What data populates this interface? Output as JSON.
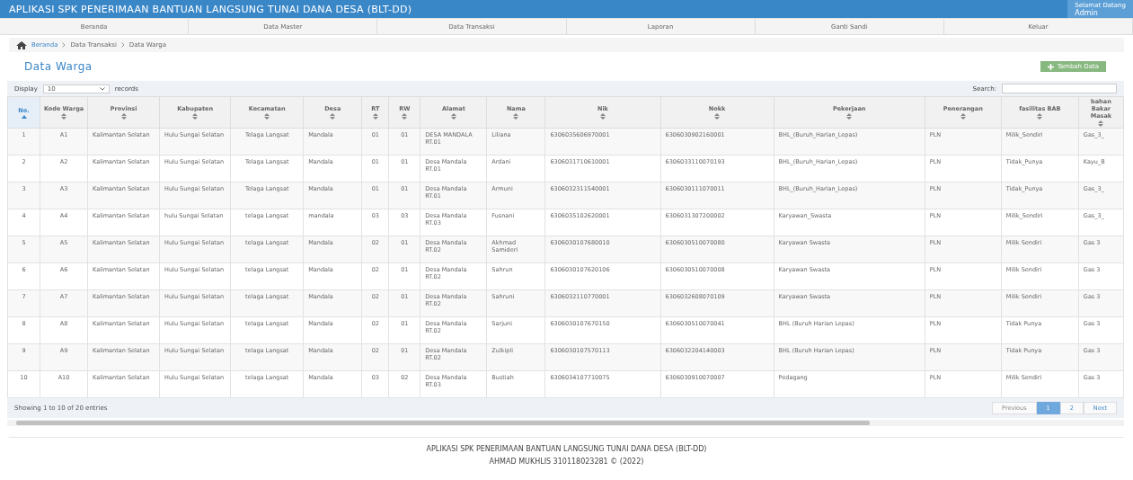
{
  "header": {
    "title": "APLIKASI SPK PENERIMAAN BANTUAN LANGSUNG TUNAI DANA DESA (BLT-DD)",
    "greeting": "Selamat Datang",
    "user": "Admin"
  },
  "nav": [
    {
      "label": "Beranda"
    },
    {
      "label": "Data Master"
    },
    {
      "label": "Data Transaksi"
    },
    {
      "label": "Laporan"
    },
    {
      "label": "Ganti Sandi"
    },
    {
      "label": "Keluar"
    }
  ],
  "breadcrumb": [
    {
      "label": "Beranda",
      "link": true
    },
    {
      "label": "Data Transaksi",
      "link": false
    },
    {
      "label": "Data Warga",
      "link": false
    }
  ],
  "page_title": "Data Warga",
  "add_button": "Tambah Data",
  "length": {
    "label": "Display",
    "value": "10",
    "suffix": "records"
  },
  "search": {
    "label": "Search:"
  },
  "table": {
    "columns": [
      {
        "label": "No.",
        "sorted": true
      },
      {
        "label": "Kode Warga",
        "sorted": false
      },
      {
        "label": "Provinsi",
        "sorted": false
      },
      {
        "label": "Kabupaten",
        "sorted": false
      },
      {
        "label": "Kecamatan",
        "sorted": false
      },
      {
        "label": "Desa",
        "sorted": false
      },
      {
        "label": "RT",
        "sorted": false
      },
      {
        "label": "RW",
        "sorted": false
      },
      {
        "label": "Alamat",
        "sorted": false
      },
      {
        "label": "Nama",
        "sorted": false
      },
      {
        "label": "Nik",
        "sorted": false
      },
      {
        "label": "Nokk",
        "sorted": false
      },
      {
        "label": "Pekerjaan",
        "sorted": false
      },
      {
        "label": "Penerangan",
        "sorted": false
      },
      {
        "label": "fasilitas BAB",
        "sorted": false
      },
      {
        "label": "bahan Bakar Masak",
        "sorted": false
      }
    ],
    "rows": [
      [
        "1",
        "A1",
        "Kalimantan Selatan",
        "Hulu Sungai Selatan",
        "Telaga Langsat",
        "Mandala",
        "01",
        "01",
        "DESA MANDALA RT.01",
        "Liliana",
        "6306035606970001",
        "6306030902160001",
        "BHL_(Buruh_Harian_Lepas)",
        "PLN",
        "Milik_Sendiri",
        "Gas_3_"
      ],
      [
        "2",
        "A2",
        "Kalimantan Selatan",
        "Hulu Sungai Selatan",
        "Telaga Langsat",
        "Mandala",
        "01",
        "01",
        "Desa Mandala RT.01",
        "Ardani",
        "6306031710610001",
        "6306033110070193",
        "BHL_(Buruh_Harian_Lepas)",
        "PLN",
        "Tidak_Punya",
        "Kayu_B"
      ],
      [
        "3",
        "A3",
        "Kalimantan Selatan",
        "Hulu Sungai Selatan",
        "Telaga Langsat",
        "Mandala",
        "01",
        "01",
        "Desa Mandala RT.01",
        "Armuni",
        "6306032311540001",
        "6306030111070011",
        "BHL_(Buruh_Harian_Lepas)",
        "PLN",
        "Tidak_Punya",
        "Gas_3_"
      ],
      [
        "4",
        "A4",
        "Kalimantan Selatan",
        "hulu Sungai Selatan",
        "telaga Langsat",
        "mandala",
        "03",
        "03",
        "Desa Mandala RT.03",
        "Fusnani",
        "6306035102620001",
        "6306031307200002",
        "Karyawan_Swasta",
        "PLN",
        "Milik_Sendiri",
        "Gas_3_"
      ],
      [
        "5",
        "A5",
        "Kalimantan Selatan",
        "Hulu Sungai Selatan",
        "telaga Langsat",
        "Mandala",
        "02",
        "01",
        "Desa Mandala RT.02",
        "Akhmad Samideri",
        "6306030107680010",
        "6306030510070080",
        "Karyawan Swasta",
        "PLN",
        "Milik Sendiri",
        "Gas 3"
      ],
      [
        "6",
        "A6",
        "Kalimantan Selatan",
        "Hulu Sungai Selatan",
        "telaga Langsat",
        "Mandala",
        "02",
        "01",
        "Desa Mandala RT.02",
        "Sahrun",
        "6306030107620106",
        "6306030510070008",
        "Karyawan Swasta",
        "PLN",
        "Milik Sendiri",
        "Gas 3"
      ],
      [
        "7",
        "A7",
        "Kalimantan Selatan",
        "Hulu Sungai Selatan",
        "telaga Langsat",
        "Mandala",
        "02",
        "01",
        "Desa Mandala RT.02",
        "Sahruni",
        "6306032110770001",
        "6306032608070109",
        "Karyawan Swasta",
        "PLN",
        "Milik Sendiri",
        "Gas 3"
      ],
      [
        "8",
        "A8",
        "Kalimantan Selatan",
        "Hulu Sungai Selatan",
        "telaga Langsat",
        "Mandala",
        "02",
        "01",
        "Desa Mandala RT.02",
        "Sarjuni",
        "6306030107670150",
        "6306030510070041",
        "BHL (Buruh Harian Lepas)",
        "PLN",
        "Tidak Punya",
        "Gas 3"
      ],
      [
        "9",
        "A9",
        "Kalimantan Selatan",
        "Hulu Sungai Selatan",
        "telaga Langsat",
        "Mandala",
        "02",
        "01",
        "Desa Mandala RT.02",
        "Zulkipli",
        "6306030107570113",
        "6306032204140003",
        "BHL (Buruh Harian Lepas)",
        "PLN",
        "Tidak Punya",
        "Gas 3"
      ],
      [
        "10",
        "A10",
        "Kalimantan Selatan",
        "Hulu Sungai Selatan",
        "telaga Langsat",
        "Mandala",
        "03",
        "02",
        "Desa Mandala RT.03",
        "Bustiah",
        "6306034107710075",
        "6306030910070007",
        "Pedagang",
        "PLN",
        "Milik Sendiri",
        "Gas 3"
      ]
    ]
  },
  "info": "Showing 1 to 10 of 20 entries",
  "pagination": [
    {
      "label": "Previous",
      "selected": false
    },
    {
      "label": "1",
      "selected": true
    },
    {
      "label": "2",
      "selected": false
    },
    {
      "label": "Next",
      "selected": false
    }
  ],
  "footer": [
    "APLIKASI SPK PENERIMAAN BANTUAN LANGSUNG TUNAI DANA DESA (BLT-DD)",
    "AHMAD MUKHLIS 310118023281 © (2022)"
  ]
}
